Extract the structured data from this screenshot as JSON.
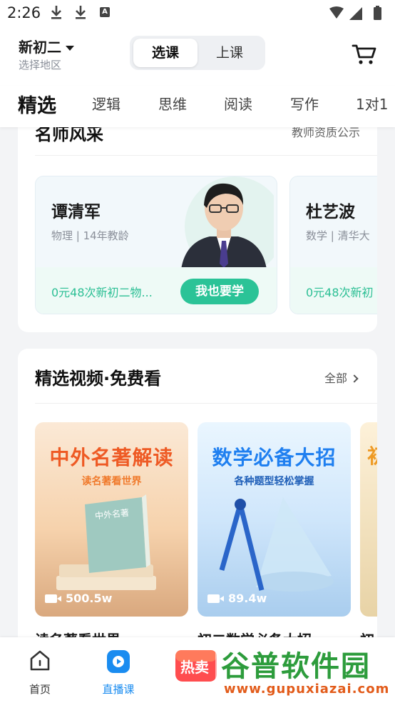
{
  "status_bar": {
    "time": "2:26",
    "a_icon": "A"
  },
  "header": {
    "grade": "新初二",
    "region": "选择地区",
    "segment": {
      "active": "选课",
      "other": "上课"
    }
  },
  "tabs": [
    "精选",
    "逻辑",
    "思维",
    "阅读",
    "写作",
    "1对1"
  ],
  "teachers_section": {
    "title": "名师风采",
    "link": "教师资质公示",
    "teachers": [
      {
        "name": "谭清军",
        "meta": "物理 | 14年教龄",
        "offer": "0元48次新初二物...",
        "cta": "我也要学"
      },
      {
        "name": "杜艺波",
        "meta": "数学 | 清华大",
        "offer": "0元48次新初"
      }
    ]
  },
  "videos_section": {
    "title": "精选视频·免费看",
    "link": "全部",
    "videos": [
      {
        "title": "中外名著解读",
        "subtitle": "读名著看世界",
        "book_text": "中外名著",
        "views": "500.5w",
        "caption": "读名著看世界"
      },
      {
        "title": "数学必备大招",
        "subtitle": "各种题型轻松掌握",
        "views": "89.4w",
        "caption": "初二数学必备大招"
      },
      {
        "title": "初",
        "caption": "初"
      }
    ]
  },
  "bottom_nav": {
    "items": [
      {
        "label": "首页"
      },
      {
        "label": "直播课"
      }
    ],
    "hot_label": "热卖"
  },
  "watermark": {
    "line1": "谷普软件园",
    "line2": "www.gupuxiazai.com"
  },
  "colors": {
    "accent_green": "#2bc397",
    "accent_blue": "#1a8cf0"
  }
}
